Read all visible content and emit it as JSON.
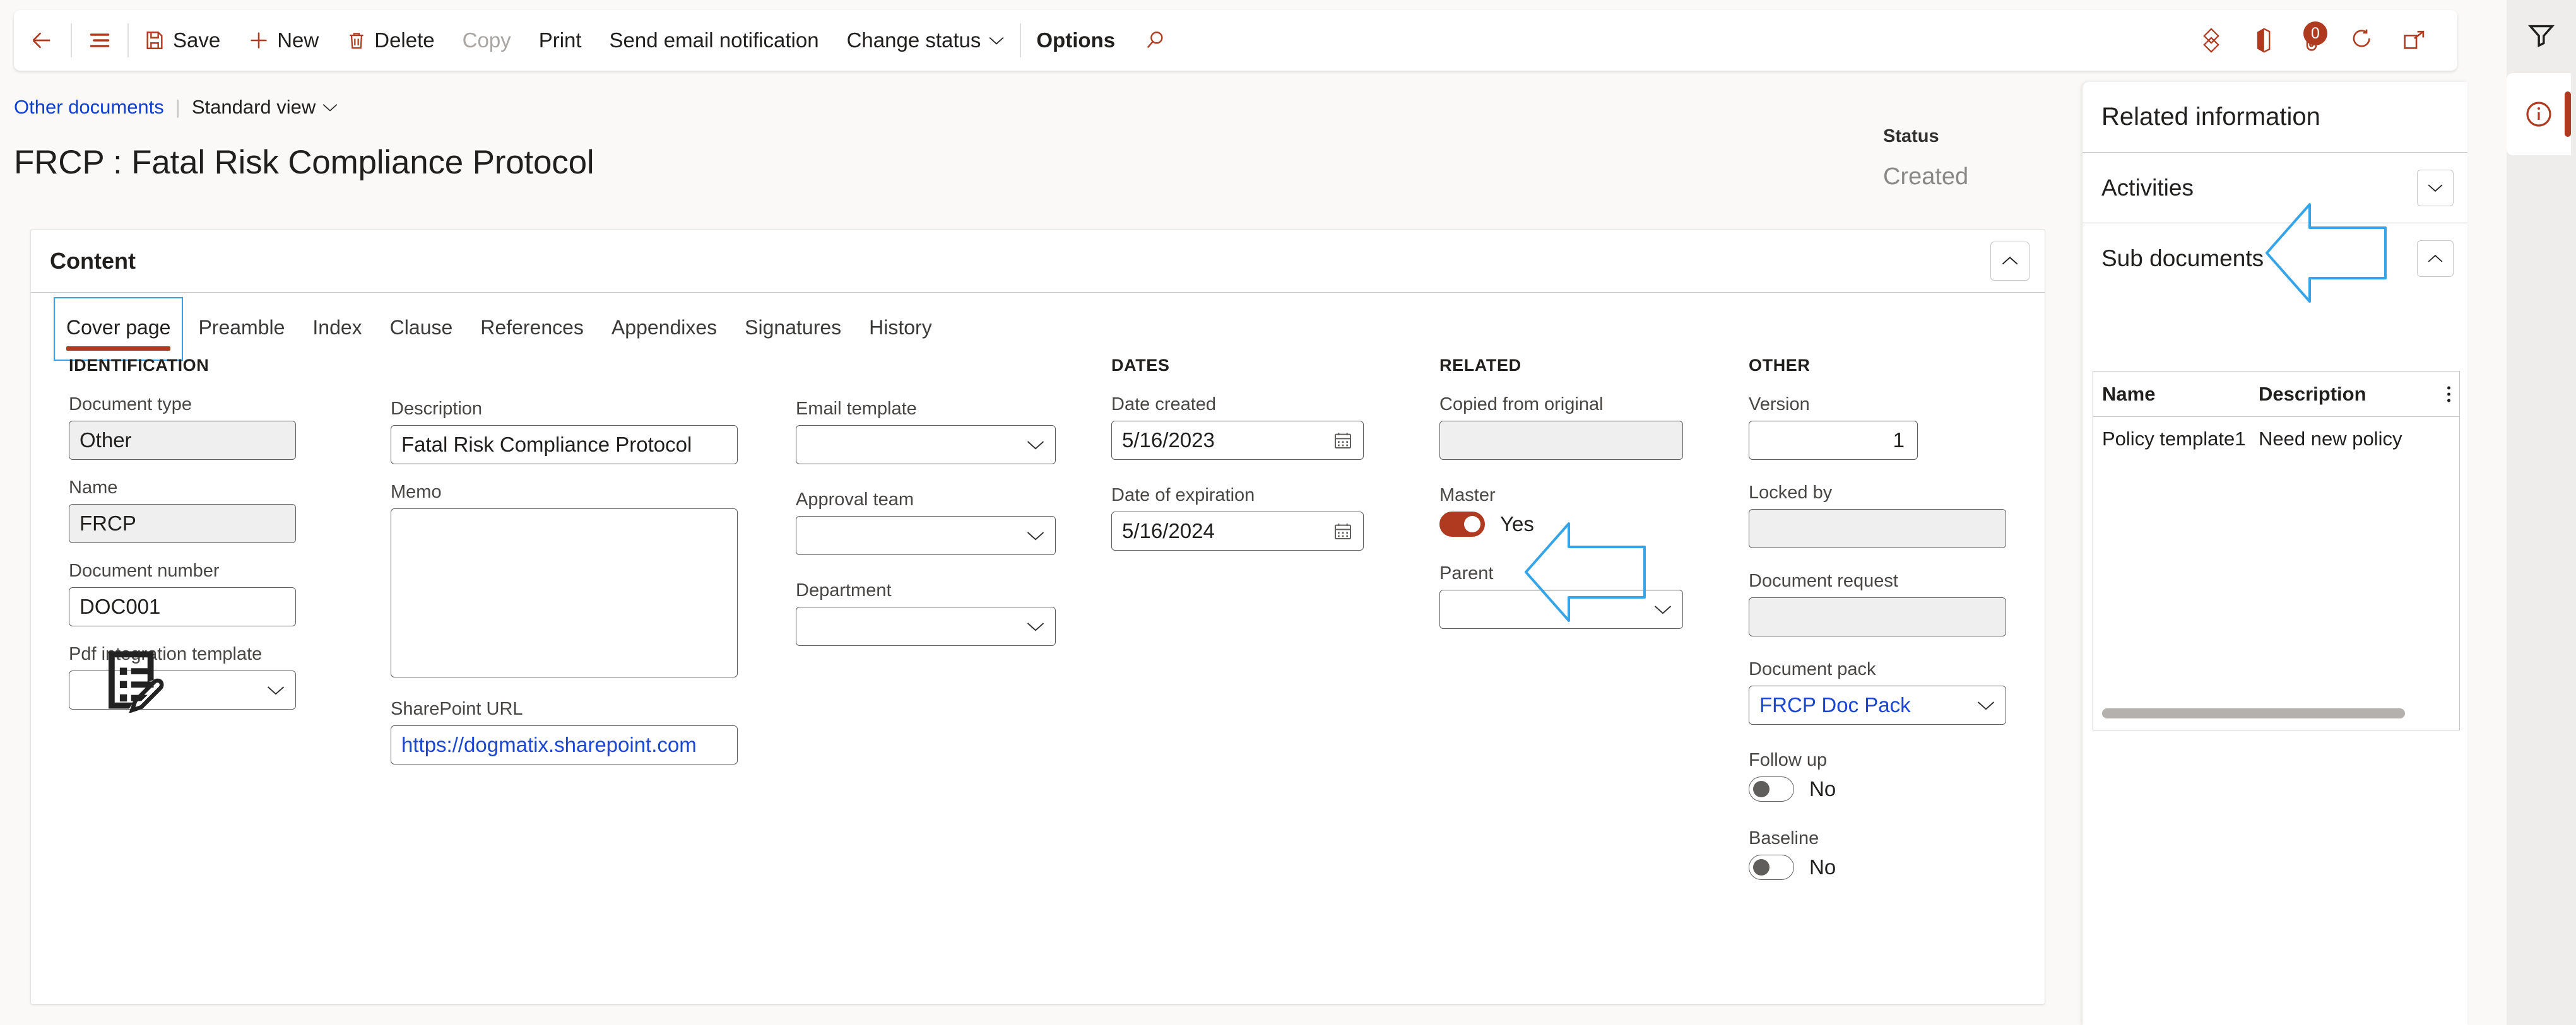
{
  "commandbar": {
    "back_label": "Back",
    "nav_label": "Show navigation pane",
    "save_label": "Save",
    "new_label": "New",
    "delete_label": "Delete",
    "copy_label": "Copy",
    "print_label": "Print",
    "send_email_label": "Send email notification",
    "change_status_label": "Change status",
    "options_label": "Options",
    "search_label": "Search",
    "right_icons": {
      "power_bi_label": "Power BI",
      "office_label": "Open in Microsoft Office",
      "attachments_label": "Attachments",
      "attachments_count": "0",
      "refresh_label": "Refresh",
      "popout_label": "Open in new window"
    }
  },
  "breadcrumb": {
    "parent_link": "Other documents",
    "separator": "|",
    "view_label": "Standard view"
  },
  "page": {
    "title": "FRCP : Fatal Risk Compliance Protocol",
    "status_label": "Status",
    "status_value": "Created"
  },
  "content_card": {
    "header": "Content",
    "tabs": [
      {
        "label": "Cover page",
        "active": true
      },
      {
        "label": "Preamble",
        "active": false
      },
      {
        "label": "Index",
        "active": false
      },
      {
        "label": "Clause",
        "active": false
      },
      {
        "label": "References",
        "active": false
      },
      {
        "label": "Appendixes",
        "active": false
      },
      {
        "label": "Signatures",
        "active": false
      },
      {
        "label": "History",
        "active": false
      }
    ]
  },
  "form": {
    "identification": {
      "group_label": "IDENTIFICATION",
      "document_type_label": "Document type",
      "document_type_value": "Other",
      "name_label": "Name",
      "name_value": "FRCP",
      "document_number_label": "Document number",
      "document_number_value": "DOC001",
      "pdf_template_label": "Pdf integration template",
      "pdf_template_value": ""
    },
    "description_col": {
      "description_label": "Description",
      "description_value": "Fatal Risk Compliance Protocol",
      "memo_label": "Memo",
      "memo_value": "",
      "sharepoint_label": "SharePoint URL",
      "sharepoint_value": "https://dogmatix.sharepoint.com"
    },
    "templates_col": {
      "email_template_label": "Email template",
      "email_template_value": "",
      "approval_team_label": "Approval team",
      "approval_team_value": "",
      "department_label": "Department",
      "department_value": ""
    },
    "dates": {
      "group_label": "DATES",
      "date_created_label": "Date created",
      "date_created_value": "5/16/2023",
      "date_expiration_label": "Date of expiration",
      "date_expiration_value": "5/16/2024"
    },
    "related": {
      "group_label": "RELATED",
      "copied_from_original_label": "Copied from original",
      "copied_from_original_value": "",
      "master_label": "Master",
      "master_value": "Yes",
      "master_on": true,
      "parent_label": "Parent",
      "parent_value": ""
    },
    "other": {
      "group_label": "OTHER",
      "version_label": "Version",
      "version_value": "1",
      "locked_by_label": "Locked by",
      "locked_by_value": "",
      "document_request_label": "Document request",
      "document_request_value": "",
      "document_pack_label": "Document pack",
      "document_pack_value": "FRCP Doc Pack",
      "follow_up_label": "Follow up",
      "follow_up_value": "No",
      "follow_up_on": false,
      "baseline_label": "Baseline",
      "baseline_value": "No",
      "baseline_on": false
    }
  },
  "right_panel": {
    "title": "Related information",
    "activities_label": "Activities",
    "sub_documents_label": "Sub documents",
    "grid": {
      "columns": [
        "Name",
        "Description"
      ],
      "rows": [
        {
          "name": "Policy template1",
          "description": "Need new policy"
        }
      ]
    }
  },
  "rail": {
    "filter_label": "Filters",
    "info_label": "Related information"
  },
  "colors": {
    "accent": "#b03a1f",
    "link": "#1a46d4",
    "annotation": "#36a4e8",
    "page_bg": "#faf9f8"
  }
}
